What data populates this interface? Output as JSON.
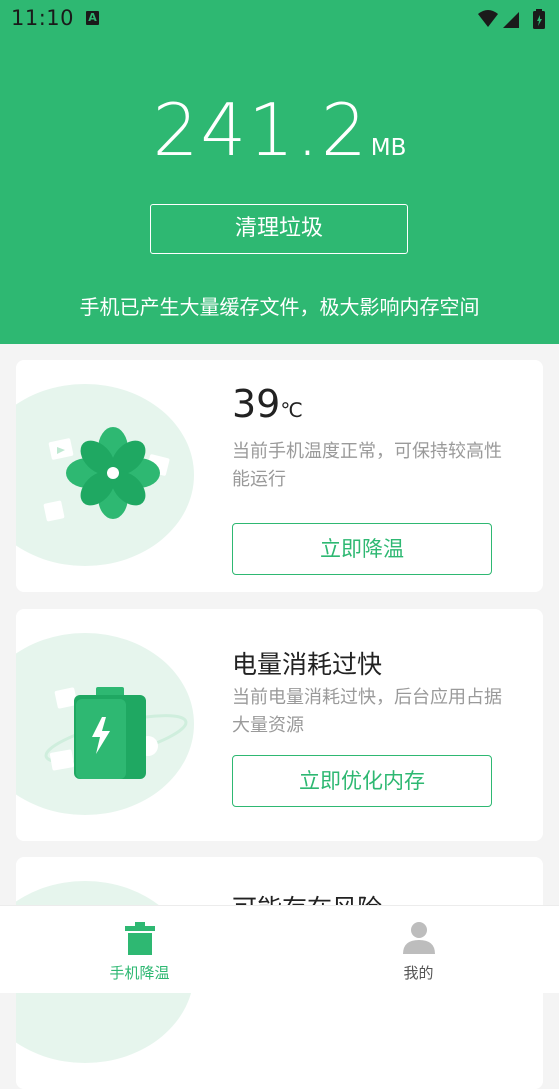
{
  "status_bar": {
    "time": "11:10",
    "badge": "A"
  },
  "header": {
    "size_value": "241.2",
    "size_unit": "MB",
    "clean_button": "清理垃圾",
    "tip": "手机已产生大量缓存文件，极大影响内存空间"
  },
  "cards": [
    {
      "title_value": "39",
      "title_unit": "℃",
      "description": "当前手机温度正常，可保持较高性能运行",
      "button": "立即降温",
      "icon": "fan-icon"
    },
    {
      "title": "电量消耗过快",
      "description": "当前电量消耗过快，后台应用占据大量资源",
      "button": "立即优化内存",
      "icon": "battery-icon"
    },
    {
      "title": "可能存在风险",
      "icon": "shield-icon"
    }
  ],
  "bottom_nav": [
    {
      "label": "手机降温",
      "icon": "trash-icon",
      "active": true
    },
    {
      "label": "我的",
      "icon": "user-icon",
      "active": false
    }
  ],
  "colors": {
    "accent": "#2eb872",
    "inactive": "#555555"
  }
}
